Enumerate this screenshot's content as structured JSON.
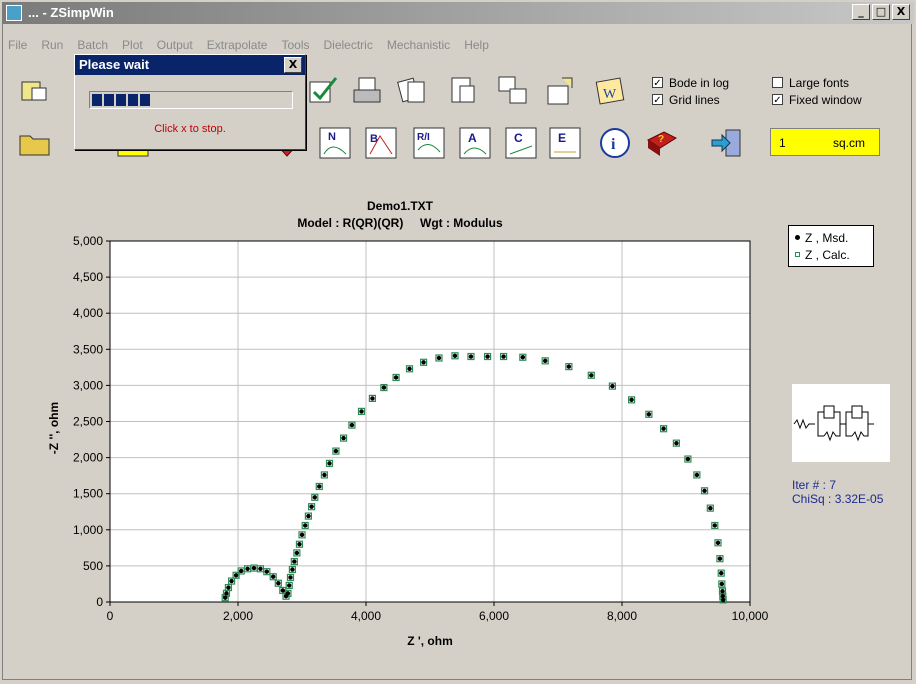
{
  "window": {
    "title": "... - ZSimpWin",
    "buttons": [
      "_",
      "□",
      "X"
    ]
  },
  "menu": [
    "File",
    "Run",
    "Batch",
    "Plot",
    "Output",
    "Extrapolate",
    "Tools",
    "Dielectric",
    "Mechanistic",
    "Help"
  ],
  "toolbar": {
    "row1_icons": [
      "open-model-icon",
      "save-model-icon",
      "edit-check-icon",
      "printer-icon",
      "copy-docs-icon",
      "page-icon",
      "windows-icon",
      "export-icon",
      "report-icon"
    ],
    "row2_icons": [
      "open-folder-icon",
      "data-icon",
      "fit-icon",
      "notes-icon",
      "view-icon",
      "download-icon",
      "nyquist-plot-icon",
      "bode-plot-icon",
      "real-imag-plot-icon",
      "admittance-plot-icon",
      "capacitance-plot-icon",
      "dielectric-plot-icon",
      "info-icon",
      "help-book-icon",
      "exit-icon"
    ],
    "row2_labels": [
      "N",
      "B",
      "R/I",
      "A",
      "C",
      "E"
    ],
    "options": [
      {
        "label": "Bode in log",
        "checked": true
      },
      {
        "label": "Grid lines",
        "checked": true
      },
      {
        "label": "Large fonts",
        "checked": false
      },
      {
        "label": "Fixed window",
        "checked": true
      }
    ],
    "area": {
      "value": "1",
      "unit": "sq.cm"
    }
  },
  "dialog": {
    "title": "Please wait",
    "close": "X",
    "message": "Click x to stop.",
    "progress": 0.32
  },
  "legend": {
    "measured": "Z , Msd.",
    "calculated": "Z , Calc."
  },
  "stats": {
    "iter_label": "Iter # :",
    "iter_value": "7",
    "chisq_label": "ChiSq :",
    "chisq_value": "3.32E-05"
  },
  "colors": {
    "accent": "#0a246a",
    "measured": "#000000",
    "calculated": "#2e8b57",
    "area_bg": "#ffff00"
  },
  "chart_data": {
    "type": "scatter",
    "title": "Demo1.TXT",
    "subtitle": "Model : R(QR)(QR)     Wgt : Modulus",
    "xlabel": "Z ', ohm",
    "ylabel": "-Z '', ohm",
    "xlim": [
      0,
      10000
    ],
    "ylim": [
      0,
      5000
    ],
    "xticks": [
      "0",
      "2,000",
      "4,000",
      "6,000",
      "8,000",
      "10,000"
    ],
    "yticks": [
      "0",
      "500",
      "1,000",
      "1,500",
      "2,000",
      "2,500",
      "3,000",
      "3,500",
      "4,000",
      "4,500",
      "5,000"
    ],
    "grid": true,
    "legend_position": "top-right",
    "series": [
      {
        "name": "Z , Msd.",
        "marker": "dot",
        "x": [
          1800,
          1820,
          1850,
          1900,
          1970,
          2050,
          2150,
          2250,
          2350,
          2450,
          2550,
          2630,
          2700,
          2750,
          2780,
          2800,
          2820,
          2850,
          2880,
          2920,
          2960,
          3000,
          3050,
          3100,
          3150,
          3200,
          3270,
          3350,
          3430,
          3530,
          3650,
          3780,
          3930,
          4100,
          4280,
          4470,
          4680,
          4900,
          5140,
          5390,
          5640,
          5900,
          6150,
          6450,
          6800,
          7170,
          7520,
          7850,
          8150,
          8420,
          8650,
          8850,
          9030,
          9170,
          9290,
          9380,
          9450,
          9500,
          9530,
          9550,
          9560,
          9570,
          9575,
          9580
        ],
        "y": [
          60,
          120,
          200,
          290,
          370,
          430,
          460,
          470,
          460,
          420,
          350,
          260,
          160,
          80,
          120,
          230,
          340,
          450,
          560,
          680,
          800,
          930,
          1060,
          1190,
          1320,
          1450,
          1600,
          1760,
          1920,
          2090,
          2270,
          2450,
          2640,
          2820,
          2970,
          3110,
          3230,
          3320,
          3380,
          3410,
          3400,
          3400,
          3400,
          3390,
          3340,
          3260,
          3140,
          2990,
          2800,
          2600,
          2400,
          2200,
          1980,
          1760,
          1540,
          1300,
          1060,
          820,
          600,
          400,
          250,
          150,
          80,
          30
        ]
      },
      {
        "name": "Z , Calc.",
        "marker": "square",
        "x": [
          1800,
          1820,
          1850,
          1900,
          1970,
          2050,
          2150,
          2250,
          2350,
          2450,
          2550,
          2630,
          2700,
          2750,
          2780,
          2800,
          2820,
          2850,
          2880,
          2920,
          2960,
          3000,
          3050,
          3100,
          3150,
          3200,
          3270,
          3350,
          3430,
          3530,
          3650,
          3780,
          3930,
          4100,
          4280,
          4470,
          4680,
          4900,
          5140,
          5390,
          5640,
          5900,
          6150,
          6450,
          6800,
          7170,
          7520,
          7850,
          8150,
          8420,
          8650,
          8850,
          9030,
          9170,
          9290,
          9380,
          9450,
          9500,
          9530,
          9550,
          9560,
          9570,
          9575,
          9580
        ],
        "y": [
          60,
          120,
          200,
          290,
          370,
          430,
          460,
          470,
          460,
          420,
          350,
          260,
          160,
          80,
          120,
          230,
          340,
          450,
          560,
          680,
          800,
          930,
          1060,
          1190,
          1320,
          1450,
          1600,
          1760,
          1920,
          2090,
          2270,
          2450,
          2640,
          2820,
          2970,
          3110,
          3230,
          3320,
          3380,
          3410,
          3400,
          3400,
          3400,
          3390,
          3340,
          3260,
          3140,
          2990,
          2800,
          2600,
          2400,
          2200,
          1980,
          1760,
          1540,
          1300,
          1060,
          820,
          600,
          400,
          250,
          150,
          80,
          30
        ]
      }
    ]
  }
}
